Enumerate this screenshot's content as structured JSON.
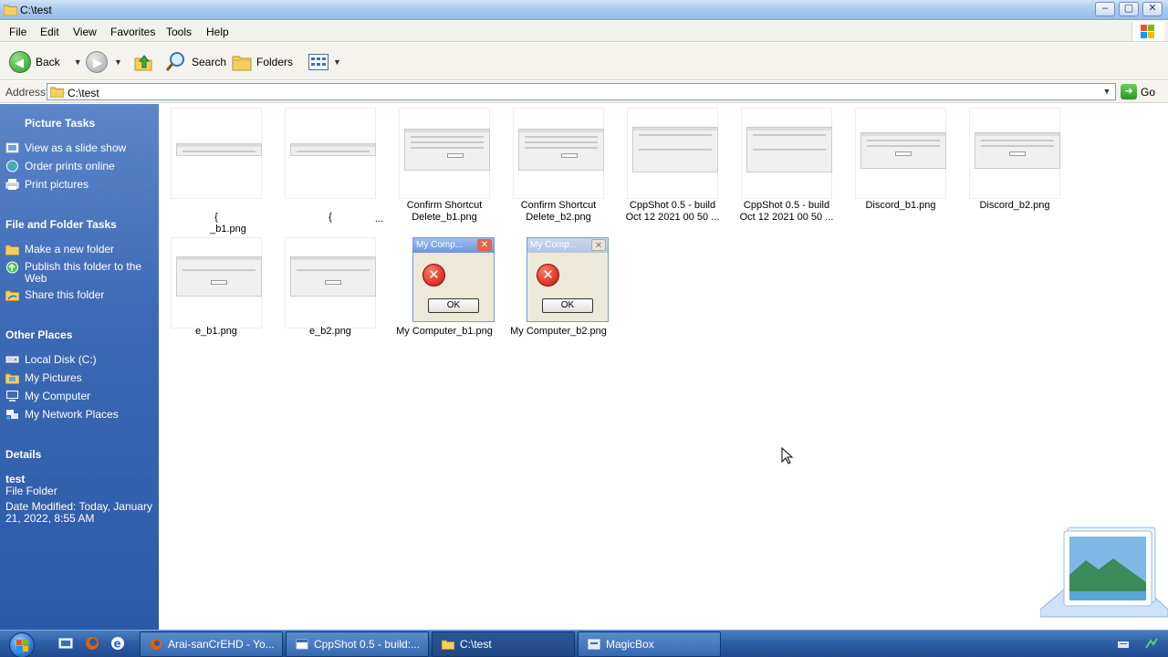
{
  "window": {
    "title": "C:\\test",
    "controls": [
      "minimize",
      "maximize",
      "close"
    ]
  },
  "menu": [
    "File",
    "Edit",
    "View",
    "Favorites",
    "Tools",
    "Help"
  ],
  "toolbar": {
    "back_label": "Back",
    "search_label": "Search",
    "folders_label": "Folders"
  },
  "address": {
    "label": "Address",
    "value": "C:\\test",
    "go_label": "Go"
  },
  "taskpane": {
    "picture_tasks": {
      "heading": "Picture Tasks",
      "items": [
        "View as a slide show",
        "Order prints online",
        "Print pictures"
      ]
    },
    "file_tasks": {
      "heading": "File and Folder Tasks",
      "items": [
        "Make a new folder",
        "Publish this folder to the Web",
        "Share this folder"
      ]
    },
    "other_places": {
      "heading": "Other Places",
      "items": [
        "Local Disk (C:)",
        "My Pictures",
        "My Computer",
        "My Network Places"
      ]
    },
    "details": {
      "heading": "Details",
      "name": "test",
      "type": "File Folder",
      "modified": "Date Modified: Today, January 21, 2022, 8:55 AM"
    }
  },
  "files": [
    {
      "line1": "{",
      "line2": "_b1.png"
    },
    {
      "line1": "{",
      "line2": "..."
    },
    {
      "line1": "Confirm Shortcut",
      "line2": "Delete_b1.png"
    },
    {
      "line1": "Confirm Shortcut",
      "line2": "Delete_b2.png"
    },
    {
      "line1": "CppShot 0.5 - build",
      "line2": "Oct 12 2021 00 50 ..."
    },
    {
      "line1": "CppShot 0.5 - build",
      "line2": "Oct 12 2021 00 50 ..."
    },
    {
      "line1": "Discord_b1.png",
      "line2": ""
    },
    {
      "line1": "Discord_b2.png",
      "line2": ""
    },
    {
      "line1": "e_b1.png",
      "line2": ""
    },
    {
      "line1": "e_b2.png",
      "line2": ""
    },
    {
      "line1": "My Computer_b1.png",
      "line2": ""
    },
    {
      "line1": "My Computer_b2.png",
      "line2": ""
    }
  ],
  "thumb_text": {
    "err_title": "My Comp...",
    "err_ok": "OK"
  },
  "taskbar": {
    "tasks": [
      "Arai-sanCrEHD - Yo...",
      "CppShot 0.5 - build:...",
      "C:\\test",
      "MagicBox"
    ],
    "active_task": "C:\\test"
  },
  "colors": {
    "taskpane": "#3c6ab6",
    "titlebar": "#a9c9ec",
    "taskbar": "#2d5fa6"
  }
}
